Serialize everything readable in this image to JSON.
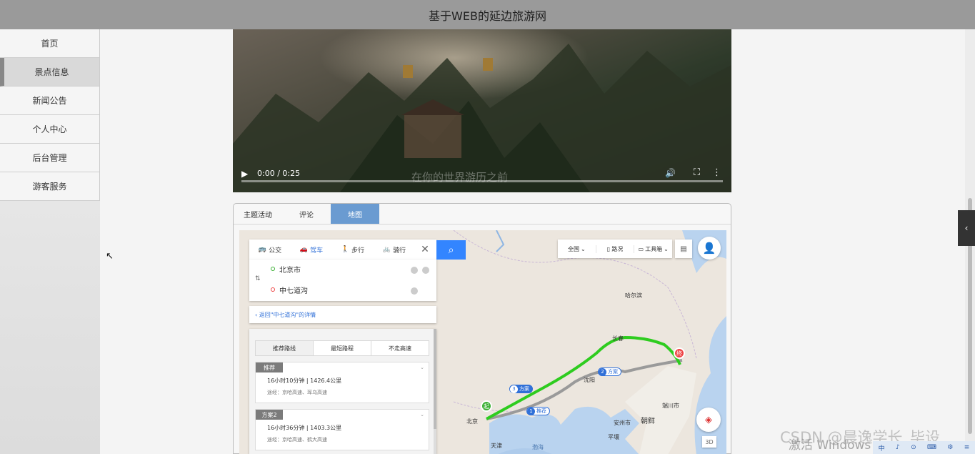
{
  "header": {
    "title": "基于WEB的延边旅游网"
  },
  "sidebar": {
    "items": [
      {
        "label": "首页"
      },
      {
        "label": "景点信息"
      },
      {
        "label": "新闻公告"
      },
      {
        "label": "个人中心"
      },
      {
        "label": "后台管理"
      },
      {
        "label": "游客服务"
      }
    ]
  },
  "video": {
    "time": "0:00 / 0:25",
    "caption": "在你的世界游历之前",
    "progress": 0
  },
  "panel": {
    "tabs": [
      {
        "label": "主题活动"
      },
      {
        "label": "评论"
      },
      {
        "label": "地图"
      }
    ]
  },
  "map": {
    "modes": [
      {
        "label": "公交"
      },
      {
        "label": "驾车"
      },
      {
        "label": "步行"
      },
      {
        "label": "骑行"
      }
    ],
    "start": "北京市",
    "end": "中七道沟",
    "back_link": "返回\"中七道沟\"的详情",
    "plan_tabs": [
      {
        "label": "推荐路线"
      },
      {
        "label": "最短路程"
      },
      {
        "label": "不走高速"
      }
    ],
    "plans": [
      {
        "badge": "推荐",
        "duration": "16小时10分钟",
        "distance": "1426.4公里",
        "via": "途经：京哈高速、珲乌高速"
      },
      {
        "badge": "方案2",
        "duration": "16小时36分钟",
        "distance": "1403.3公里",
        "via": "途经：京哈高速、鹤大高速"
      }
    ],
    "tools": [
      {
        "label": "全国"
      },
      {
        "label": "路况"
      },
      {
        "label": "工具箱"
      }
    ],
    "btn_3d": "3D",
    "cities": [
      {
        "name": "哈尔滨"
      },
      {
        "name": "长春"
      },
      {
        "name": "沈阳"
      },
      {
        "name": "北京"
      },
      {
        "name": "天津"
      },
      {
        "name": "渤海"
      },
      {
        "name": "安州市"
      },
      {
        "name": "朝鲜"
      },
      {
        "name": "平壤"
      },
      {
        "name": "端川市"
      }
    ],
    "route_tags": [
      {
        "n": "1",
        "label": "推荐"
      },
      {
        "n": "2",
        "label": "方案"
      },
      {
        "n": "3",
        "label": "方案"
      }
    ],
    "start_pin": "起",
    "end_pin": "终"
  },
  "overlay": {
    "watermark": "CSDN @晨逸学长_毕设",
    "activate": "激活 Windows",
    "tray": [
      "中",
      "♪",
      "⊙",
      "⌨",
      "⚙",
      "≡"
    ]
  },
  "colors": {
    "header": "#9a9a9a",
    "accent": "#6a9bd1",
    "route_main": "#2ecc1f",
    "route_alt": "#9a9a9a",
    "map_water": "#b9d3ef"
  }
}
